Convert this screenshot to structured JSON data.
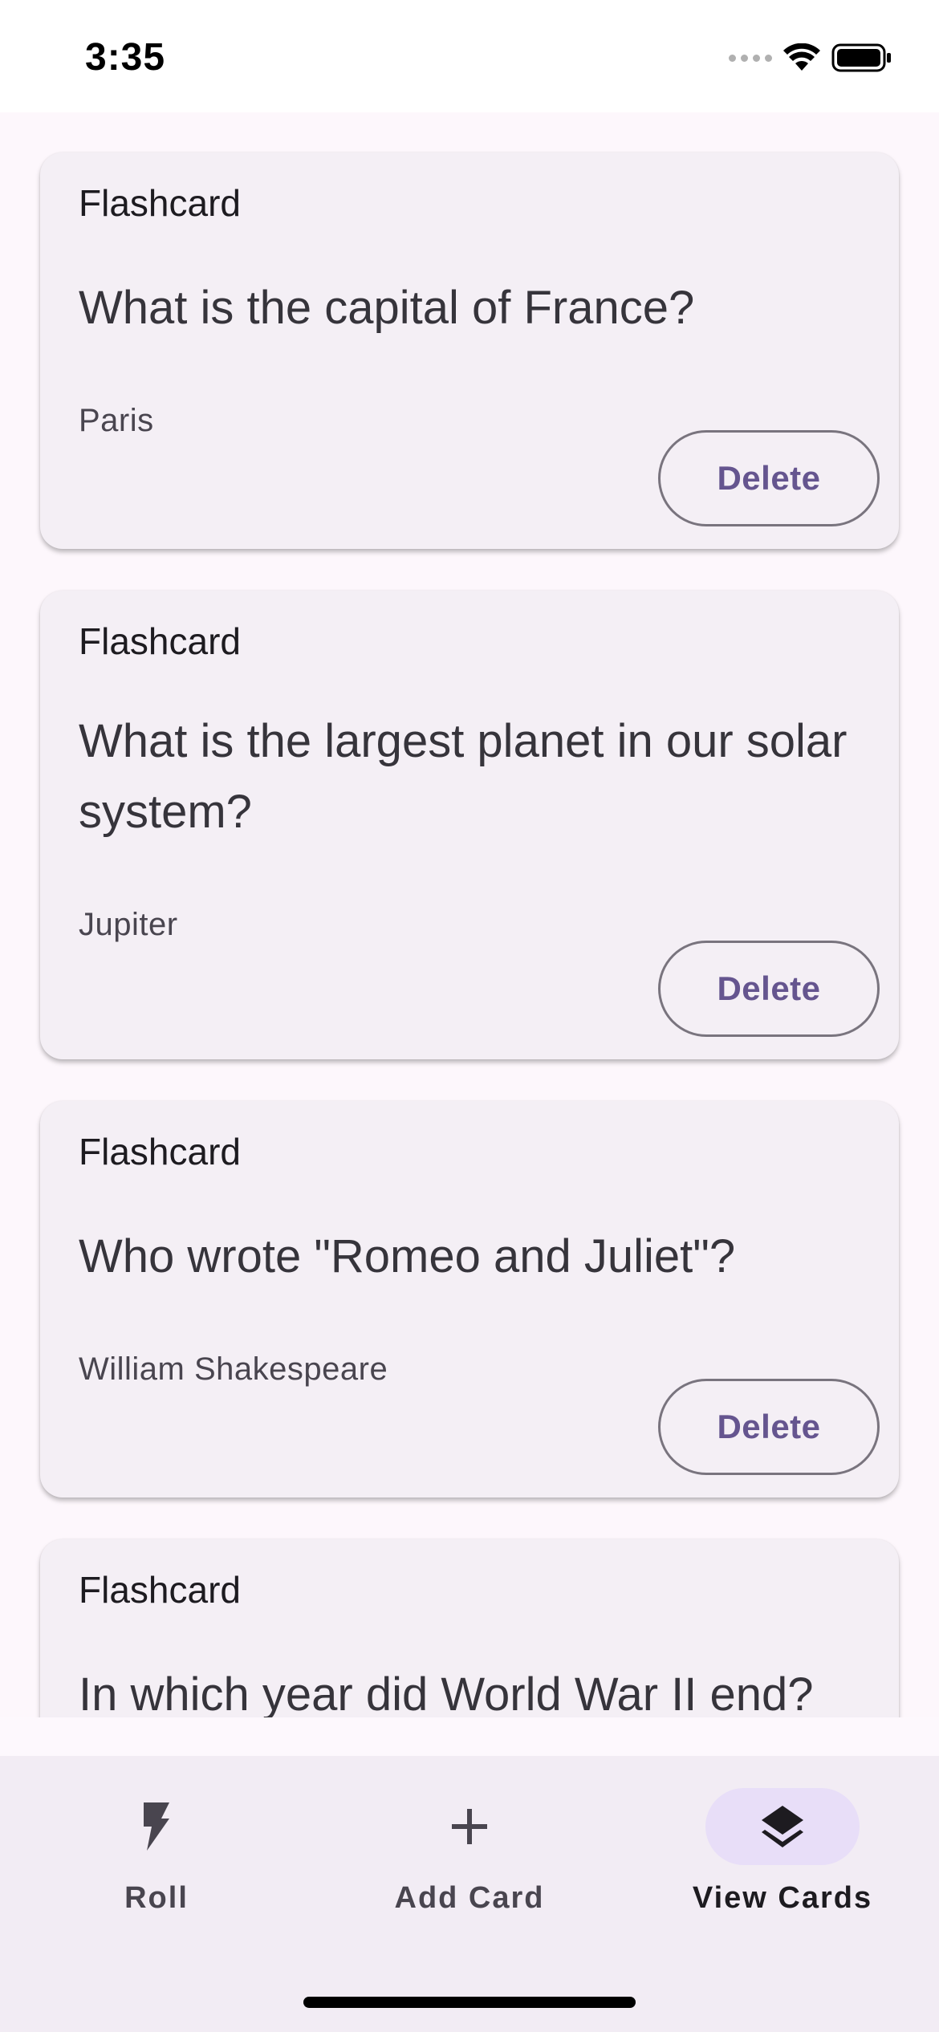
{
  "status_bar": {
    "time": "3:35"
  },
  "cards": [
    {
      "label": "Flashcard",
      "question": "What is the capital of France?",
      "answer": "Paris",
      "delete_label": "Delete"
    },
    {
      "label": "Flashcard",
      "question": "What is the largest planet in our solar system?",
      "answer": "Jupiter",
      "delete_label": "Delete"
    },
    {
      "label": "Flashcard",
      "question": "Who wrote \"Romeo and Juliet\"?",
      "answer": "William Shakespeare",
      "delete_label": "Delete"
    },
    {
      "label": "Flashcard",
      "question": "In which year did World War II end?"
    }
  ],
  "nav": {
    "items": [
      {
        "label": "Roll",
        "icon": "bolt-icon",
        "active": false
      },
      {
        "label": "Add Card",
        "icon": "plus-icon",
        "active": false
      },
      {
        "label": "View Cards",
        "icon": "layers-icon",
        "active": true
      }
    ]
  },
  "colors": {
    "accent": "#65558f",
    "active_indicator": "#e8def8",
    "card_bg": "#f4eff5",
    "nav_bg": "#f2ecf4"
  }
}
